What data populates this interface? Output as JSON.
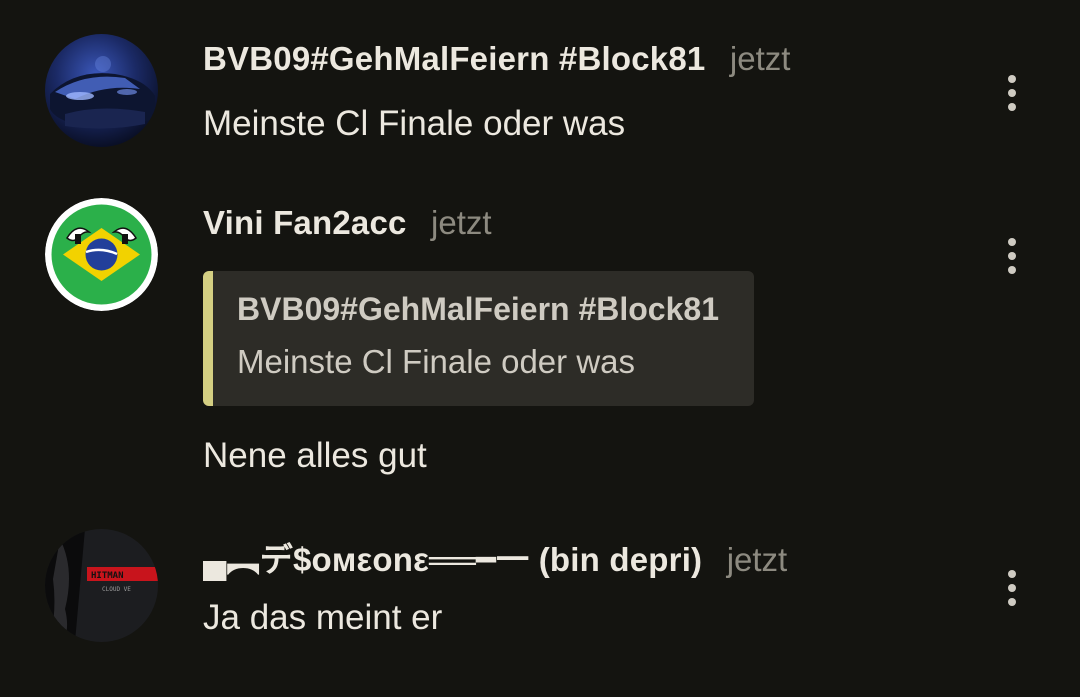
{
  "comments": [
    {
      "username": "BVB09#GehMalFeiern #Block81",
      "time": "jetzt",
      "text": "Meinste Cl Finale oder was",
      "avatar_icon": "blue-car-avatar"
    },
    {
      "username": "Vini Fan2acc",
      "time": "jetzt",
      "quote": {
        "username": "BVB09#GehMalFeiern #Block81",
        "text": "Meinste Cl Finale oder was"
      },
      "text": "Nene alles gut",
      "avatar_icon": "brazil-ball-avatar"
    },
    {
      "username": "▄︻デ$oмεonε══━一 (bin depri)",
      "time": "jetzt",
      "text": "Ja das meint er",
      "avatar_icon": "hitman-avatar",
      "avatar_text": "HITMAN",
      "avatar_subtext": "CLOUD VE"
    }
  ],
  "colors": {
    "background": "#141410",
    "quote_bar": "#d4cf82",
    "quote_bg": "#2d2c27",
    "text": "#ece8df",
    "muted": "#8d8a80"
  },
  "menu_icon": "more-vertical-icon"
}
